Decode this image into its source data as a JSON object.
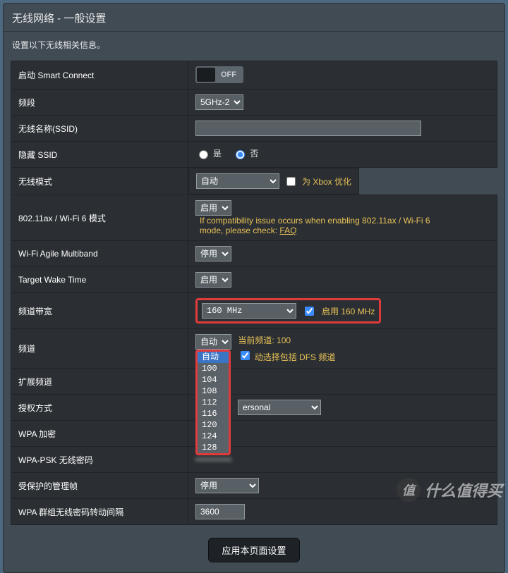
{
  "header": {
    "title": "无线网络 - 一般设置",
    "description": "设置以下无线相关信息。"
  },
  "rows": {
    "smart_connect": {
      "label": "启动 Smart Connect",
      "state": "OFF"
    },
    "band": {
      "label": "频段",
      "value": "5GHz-2"
    },
    "ssid": {
      "label": "无线名称(SSID)",
      "value": ""
    },
    "hide_ssid": {
      "label": "隐藏 SSID",
      "yes": "是",
      "no": "否",
      "value": "no"
    },
    "mode": {
      "label": "无线模式",
      "value": "自动",
      "xbox": "为 Xbox 优化"
    },
    "ax": {
      "label": "802.11ax / Wi-Fi 6 模式",
      "value": "启用",
      "note_pre": "If compatibility issue occurs when enabling 802.11ax / Wi-Fi 6 mode, please check: ",
      "faq": "FAQ"
    },
    "agile": {
      "label": "Wi-Fi Agile Multiband",
      "value": "停用"
    },
    "twt": {
      "label": "Target Wake Time",
      "value": "启用"
    },
    "bw": {
      "label": "频道带宽",
      "value": "160 MHz",
      "chk": "启用 160 MHz"
    },
    "chan": {
      "label": "频道",
      "value": "自动",
      "current_lbl": "当前频道: ",
      "current_val": "100",
      "dfs_lbl": "动选择包括 DFS 频道",
      "options": [
        "自动",
        "100",
        "104",
        "108",
        "112",
        "116",
        "120",
        "124",
        "128"
      ]
    },
    "ext": {
      "label": "扩展频道"
    },
    "auth": {
      "label": "授权方式",
      "value_suffix": "ersonal"
    },
    "wpa_enc": {
      "label": "WPA 加密"
    },
    "psk": {
      "label": "WPA-PSK 无线密码",
      "value": "••••••••••"
    },
    "pmf": {
      "label": "受保护的管理帧",
      "value": "停用"
    },
    "grk": {
      "label": "WPA 群组无线密码转动间隔",
      "value": "3600"
    }
  },
  "apply": "应用本页面设置",
  "watermark": "什么值得买"
}
